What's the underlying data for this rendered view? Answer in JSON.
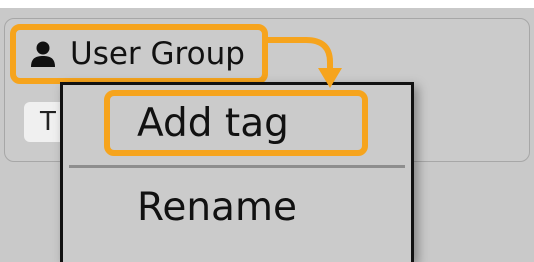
{
  "group_header": {
    "label": "User Group",
    "icon": "person-icon"
  },
  "tag_chip": {
    "label": "T"
  },
  "context_menu": {
    "items": [
      {
        "label": "Add tag"
      },
      {
        "label": "Rename"
      }
    ]
  },
  "colors": {
    "highlight": "#f6a41d",
    "background": "#c9c9c9"
  }
}
